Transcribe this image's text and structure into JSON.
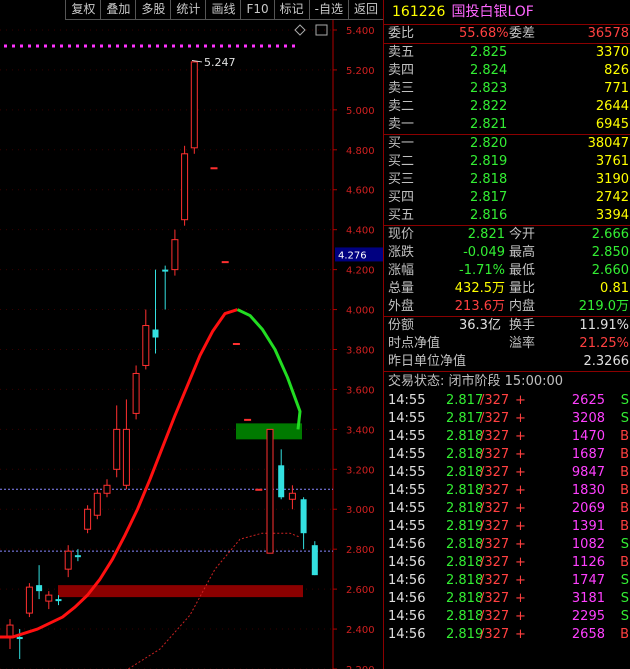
{
  "toolbar": {
    "items": [
      "复权",
      "叠加",
      "多股",
      "统计",
      "画线",
      "F10",
      "标记",
      "-自选",
      "返回"
    ]
  },
  "chart": {
    "price_axis": [
      "5.400",
      "5.200",
      "5.000",
      "4.800",
      "4.600",
      "4.400",
      "4.200",
      "4.000",
      "3.800",
      "3.600",
      "3.400",
      "3.200",
      "3.000",
      "2.800",
      "2.600",
      "2.400",
      "2.200"
    ],
    "current_price_tag": "4.276",
    "high_label": "5.247",
    "icons": {
      "diamond": "diamond-icon",
      "window": "window-icon"
    }
  },
  "chart_data": {
    "type": "candlestick",
    "ylim": [
      2.2,
      5.45
    ],
    "candles": [
      {
        "o": 2.36,
        "c": 2.42,
        "h": 2.45,
        "l": 2.3
      },
      {
        "o": 2.36,
        "c": 2.35,
        "h": 2.4,
        "l": 2.25
      },
      {
        "o": 2.48,
        "c": 2.61,
        "h": 2.63,
        "l": 2.46
      },
      {
        "o": 2.62,
        "c": 2.59,
        "h": 2.72,
        "l": 2.55
      },
      {
        "o": 2.54,
        "c": 2.57,
        "h": 2.59,
        "l": 2.5
      },
      {
        "o": 2.55,
        "c": 2.54,
        "h": 2.57,
        "l": 2.52
      },
      {
        "o": 2.7,
        "c": 2.79,
        "h": 2.82,
        "l": 2.66
      },
      {
        "o": 2.77,
        "c": 2.76,
        "h": 2.8,
        "l": 2.74
      },
      {
        "o": 2.9,
        "c": 3.0,
        "h": 3.02,
        "l": 2.88
      },
      {
        "o": 2.97,
        "c": 3.08,
        "h": 3.1,
        "l": 2.95
      },
      {
        "o": 3.08,
        "c": 3.12,
        "h": 3.15,
        "l": 3.06
      },
      {
        "o": 3.2,
        "c": 3.4,
        "h": 3.52,
        "l": 3.16
      },
      {
        "o": 3.12,
        "c": 3.4,
        "h": 3.55,
        "l": 3.1
      },
      {
        "o": 3.48,
        "c": 3.68,
        "h": 3.72,
        "l": 3.45
      },
      {
        "o": 3.72,
        "c": 3.92,
        "h": 4.0,
        "l": 3.7
      },
      {
        "o": 3.9,
        "c": 3.86,
        "h": 4.2,
        "l": 3.78
      },
      {
        "o": 4.2,
        "c": 4.19,
        "h": 4.22,
        "l": 4.0
      },
      {
        "o": 4.2,
        "c": 4.35,
        "h": 4.4,
        "l": 4.17
      },
      {
        "o": 4.45,
        "c": 4.78,
        "h": 4.82,
        "l": 4.42
      },
      {
        "o": 4.81,
        "c": 5.24,
        "h": 5.247,
        "l": 4.78
      },
      {
        "o": 4.71,
        "c": 4.71,
        "h": 4.71,
        "l": 4.71
      },
      {
        "o": 4.24,
        "c": 4.24,
        "h": 4.24,
        "l": 4.24
      },
      {
        "o": 3.83,
        "c": 3.83,
        "h": 3.83,
        "l": 3.83
      },
      {
        "o": 3.45,
        "c": 3.45,
        "h": 3.45,
        "l": 3.45
      },
      {
        "o": 3.1,
        "c": 3.1,
        "h": 3.1,
        "l": 3.1
      },
      {
        "o": 2.78,
        "c": 3.4,
        "h": 3.4,
        "l": 2.78
      },
      {
        "o": 3.22,
        "c": 3.06,
        "h": 3.3,
        "l": 3.05
      },
      {
        "o": 3.05,
        "c": 3.08,
        "h": 3.12,
        "l": 3.0
      },
      {
        "o": 3.05,
        "c": 2.88,
        "h": 3.06,
        "l": 2.8
      },
      {
        "o": 2.82,
        "c": 2.67,
        "h": 2.84,
        "l": 2.67
      }
    ],
    "ma_line": [
      2.36,
      2.36,
      2.38,
      2.4,
      2.43,
      2.46,
      2.51,
      2.57,
      2.65,
      2.75,
      2.87,
      3.0,
      3.15,
      3.31,
      3.47,
      3.62,
      3.77,
      3.89,
      3.98,
      4.0,
      3.97,
      3.9,
      3.8,
      3.66,
      3.49
    ],
    "reference_lines": [
      3.1,
      2.79
    ]
  },
  "quote": {
    "code": "161226",
    "name": "国投白银LOF",
    "weibi_label": "委比",
    "weibi": "55.68%",
    "weicha_label": "委差",
    "weicha": "36578",
    "asks": [
      {
        "label": "卖五",
        "price": "2.825",
        "vol": "3370"
      },
      {
        "label": "卖四",
        "price": "2.824",
        "vol": "826"
      },
      {
        "label": "卖三",
        "price": "2.823",
        "vol": "771"
      },
      {
        "label": "卖二",
        "price": "2.822",
        "vol": "2644"
      },
      {
        "label": "卖一",
        "price": "2.821",
        "vol": "6945"
      }
    ],
    "bids": [
      {
        "label": "买一",
        "price": "2.820",
        "vol": "38047"
      },
      {
        "label": "买二",
        "price": "2.819",
        "vol": "3761"
      },
      {
        "label": "买三",
        "price": "2.818",
        "vol": "3190"
      },
      {
        "label": "买四",
        "price": "2.817",
        "vol": "2742"
      },
      {
        "label": "买五",
        "price": "2.816",
        "vol": "3394"
      }
    ],
    "stats": [
      {
        "l1": "现价",
        "v1": "2.821",
        "c1": "green",
        "l2": "今开",
        "v2": "2.666",
        "c2": "green"
      },
      {
        "l1": "涨跌",
        "v1": "-0.049",
        "c1": "green",
        "l2": "最高",
        "v2": "2.850",
        "c2": "green"
      },
      {
        "l1": "涨幅",
        "v1": "-1.71%",
        "c1": "green",
        "l2": "最低",
        "v2": "2.660",
        "c2": "green"
      },
      {
        "l1": "总量",
        "v1": "432.5万",
        "c1": "yellow",
        "l2": "量比",
        "v2": "0.81",
        "c2": "yellow"
      },
      {
        "l1": "外盘",
        "v1": "213.6万",
        "c1": "red",
        "l2": "内盘",
        "v2": "219.0万",
        "c2": "green"
      }
    ],
    "fene_label": "份额",
    "fene": "36.3亿",
    "huanshou_label": "换手",
    "huanshou": "11.91%",
    "shidian_label": "时点净值",
    "yijia_label": "溢率",
    "yijia": "21.25%",
    "zuori_label": "昨日单位净值",
    "zuori": "2.3266",
    "trade_status": "交易状态: 闭市阶段 15:00:00"
  },
  "ticks": [
    {
      "time": "14:55",
      "price": "2.817",
      "hand": "/327",
      "sign": "+",
      "vol": "2625",
      "side": "S"
    },
    {
      "time": "14:55",
      "price": "2.817",
      "hand": "/327",
      "sign": "+",
      "vol": "3208",
      "side": "S"
    },
    {
      "time": "14:55",
      "price": "2.818",
      "hand": "/327",
      "sign": "+",
      "vol": "1470",
      "side": "B"
    },
    {
      "time": "14:55",
      "price": "2.818",
      "hand": "/327",
      "sign": "+",
      "vol": "1687",
      "side": "B"
    },
    {
      "time": "14:55",
      "price": "2.818",
      "hand": "/327",
      "sign": "+",
      "vol": "9847",
      "side": "B"
    },
    {
      "time": "14:55",
      "price": "2.818",
      "hand": "/327",
      "sign": "+",
      "vol": "1830",
      "side": "B"
    },
    {
      "time": "14:55",
      "price": "2.818",
      "hand": "/327",
      "sign": "+",
      "vol": "2069",
      "side": "B"
    },
    {
      "time": "14:55",
      "price": "2.819",
      "hand": "/327",
      "sign": "+",
      "vol": "1391",
      "side": "B"
    },
    {
      "time": "14:56",
      "price": "2.818",
      "hand": "/327",
      "sign": "+",
      "vol": "1082",
      "side": "S"
    },
    {
      "time": "14:56",
      "price": "2.818",
      "hand": "/327",
      "sign": "+",
      "vol": "1126",
      "side": "B"
    },
    {
      "time": "14:56",
      "price": "2.818",
      "hand": "/327",
      "sign": "+",
      "vol": "1747",
      "side": "S"
    },
    {
      "time": "14:56",
      "price": "2.818",
      "hand": "/327",
      "sign": "+",
      "vol": "3181",
      "side": "S"
    },
    {
      "time": "14:56",
      "price": "2.818",
      "hand": "/327",
      "sign": "+",
      "vol": "2295",
      "side": "S"
    },
    {
      "time": "14:56",
      "price": "2.819",
      "hand": "/327",
      "sign": "+",
      "vol": "2658",
      "side": "B"
    }
  ]
}
